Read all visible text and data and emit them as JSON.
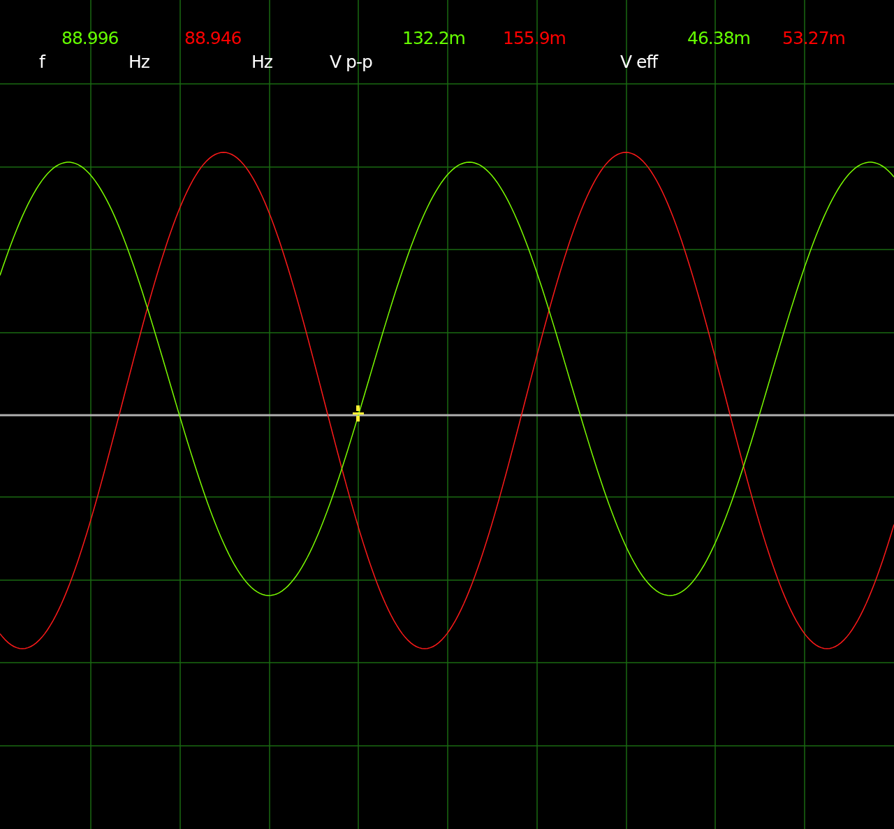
{
  "readout": {
    "values": [
      {
        "text": "88.996",
        "color": "#66ff00"
      },
      {
        "text": "88.946",
        "color": "#ff0000"
      },
      {
        "text": "132.2m",
        "color": "#66ff00"
      },
      {
        "text": "155.9m",
        "color": "#ff0000"
      },
      {
        "text": "46.38m",
        "color": "#66ff00"
      },
      {
        "text": "53.27m",
        "color": "#ff0000"
      }
    ],
    "labels": [
      "f",
      "Hz",
      "Hz",
      "V p-p",
      "V eff"
    ]
  }
}
